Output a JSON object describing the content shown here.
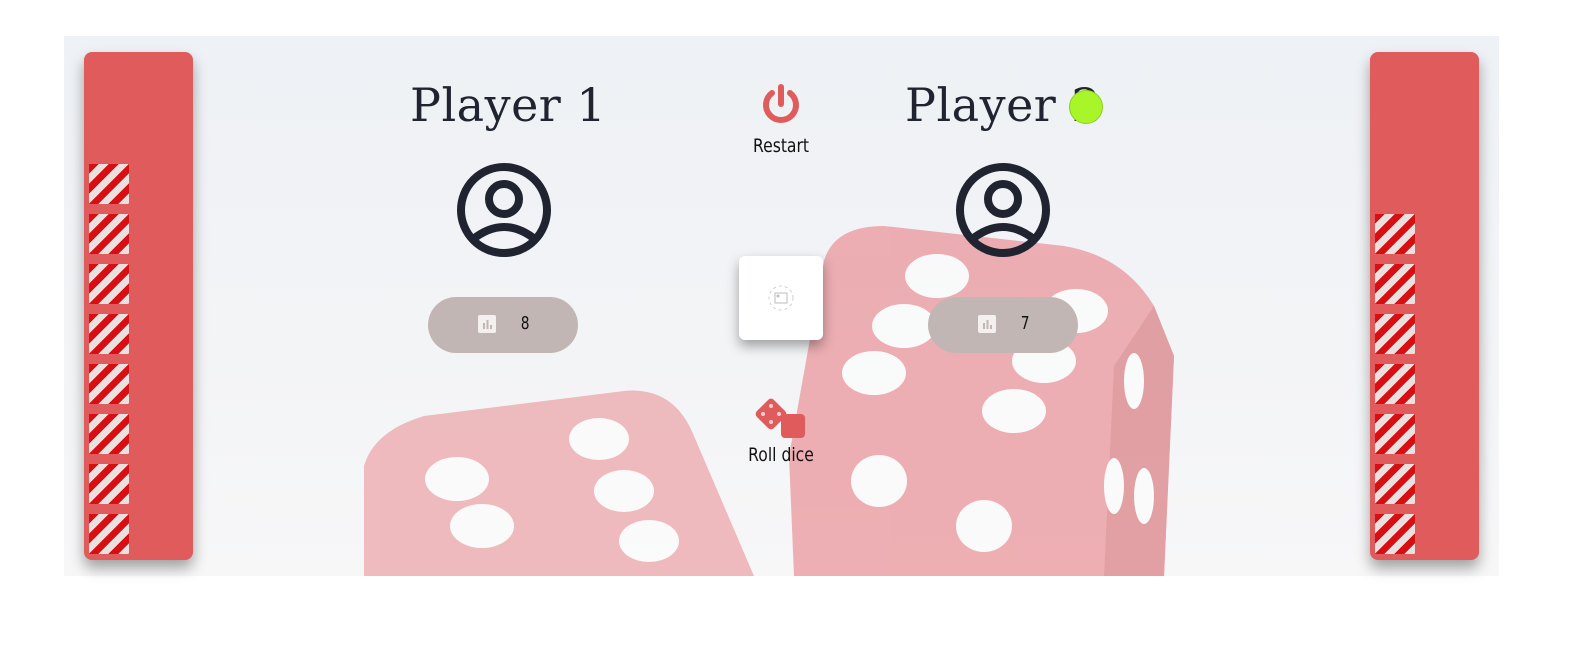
{
  "players": [
    {
      "name": "Player 1",
      "score": "8",
      "hp_blocks": 8,
      "active": false
    },
    {
      "name": "Player 2",
      "score": "7",
      "hp_blocks": 7,
      "active": true
    }
  ],
  "controls": {
    "restart_label": "Restart",
    "roll_label": "Roll dice"
  },
  "icons": {
    "restart": "power-icon",
    "roll": "dice-icon",
    "avatar": "user-circle-icon",
    "score": "bar-chart-icon",
    "dice_face": "image-placeholder-icon"
  },
  "colors": {
    "accent": "#e05b5b",
    "active_indicator": "#a8f52a",
    "hp_stripe": "#d70f12",
    "score_pill": "#c2b6b5"
  }
}
